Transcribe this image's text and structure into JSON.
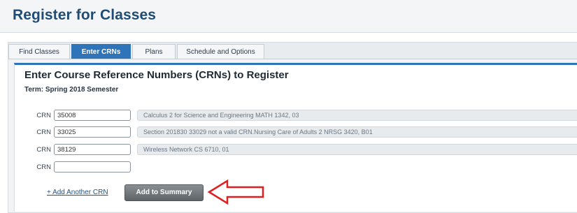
{
  "page": {
    "title": "Register for Classes"
  },
  "tabs": [
    {
      "label": "Find Classes",
      "active": false
    },
    {
      "label": "Enter CRNs",
      "active": true
    },
    {
      "label": "Plans",
      "active": false
    },
    {
      "label": "Schedule and Options",
      "active": false
    }
  ],
  "main": {
    "heading": "Enter Course Reference Numbers (CRNs) to Register",
    "term": "Term: Spring 2018 Semester",
    "crn_label": "CRN",
    "rows": [
      {
        "value": "35008",
        "description": "Calculus 2 for Science and Engineering MATH 1342, 03"
      },
      {
        "value": "33025",
        "description": "Section 201830 33029 not a valid CRN.Nursing Care of Adults 2 NRSG 3420, B01"
      },
      {
        "value": "38129",
        "description": "Wireless Network CS 6710, 01"
      },
      {
        "value": "",
        "description": ""
      }
    ],
    "add_another_label": "+ Add Another CRN",
    "add_to_summary_label": "Add to Summary"
  },
  "colors": {
    "accent": "#2f74b8",
    "title": "#1f4c74",
    "arrow": "#e02020"
  },
  "icons": {
    "annotation": "red-arrow-icon"
  }
}
